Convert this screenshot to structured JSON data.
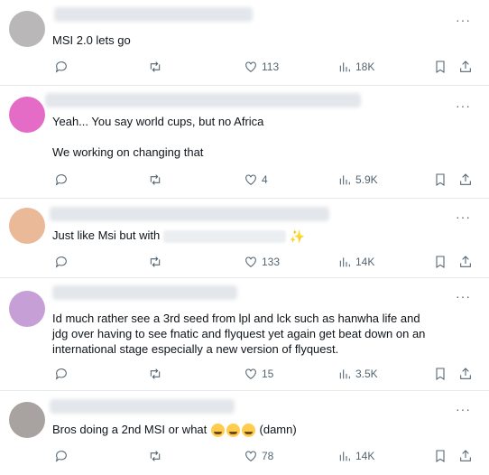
{
  "more_label": "···",
  "posts": [
    {
      "avatar_color": "#b9b7b8",
      "text": [
        "MSI 2.0 lets go"
      ],
      "likes": "113",
      "views": "18K"
    },
    {
      "avatar_color": "#e46cc7",
      "text": [
        "Yeah... You say world cups, but no Africa",
        "We working on changing that"
      ],
      "likes": "",
      "views": "5.9K"
    },
    {
      "avatar_color": "#e9b998",
      "text": [
        "Just like Msi but with"
      ],
      "likes": "133",
      "views": "14K"
    },
    {
      "avatar_color": "#c59fd6",
      "text": [
        "Id much rather see a 3rd seed from lpl and lck such as hanwha life and jdg over having to see fnatic and flyquest yet again get beat down on an international stage especially a new version of flyquest."
      ],
      "likes": "15",
      "views": "3.5K"
    },
    {
      "avatar_color": "#a8a3a0",
      "text": [
        "Bros doing a 2nd MSI or what",
        "(damn)"
      ],
      "likes": "78",
      "views": "14K"
    }
  ],
  "post2_likes": "4",
  "icons": [
    "reply-icon",
    "repost-icon",
    "like-icon",
    "views-icon",
    "bookmark-icon",
    "share-icon"
  ]
}
